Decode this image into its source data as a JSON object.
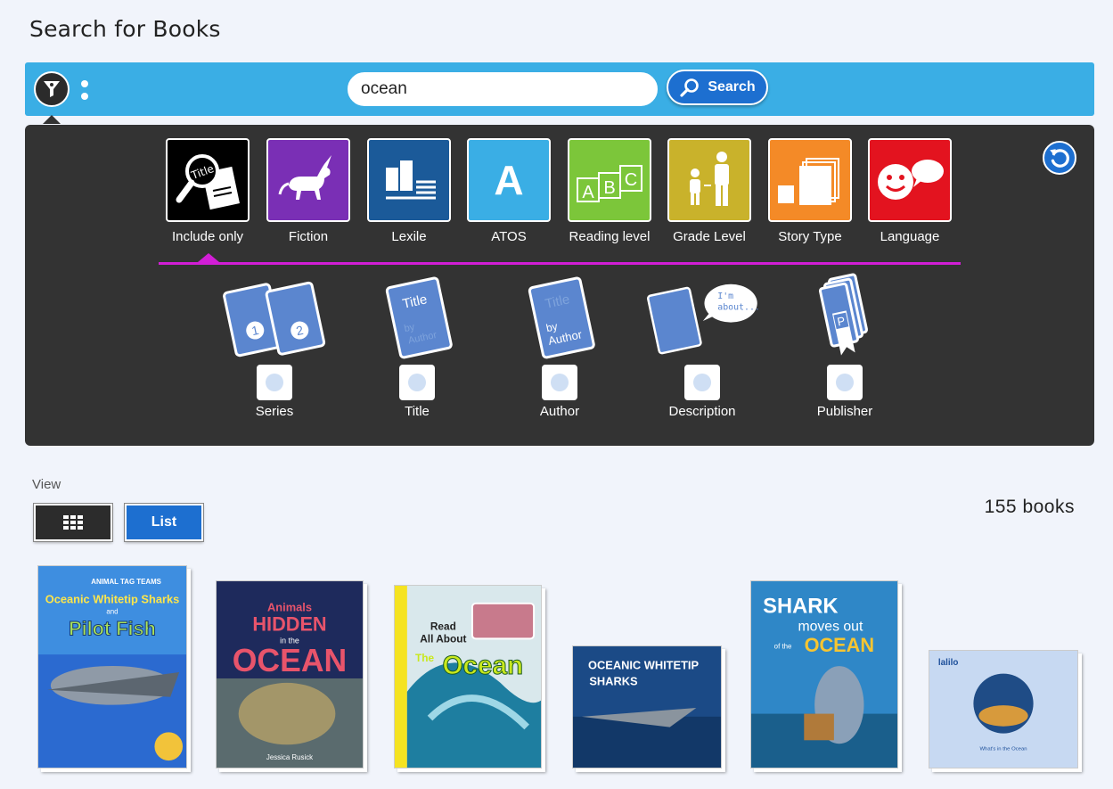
{
  "page": {
    "title": "Search for Books"
  },
  "search": {
    "query": "ocean",
    "button_label": "Search"
  },
  "categories": [
    {
      "label": "Include only",
      "icon": "title-magnifier-icon",
      "color": "#000000"
    },
    {
      "label": "Fiction",
      "icon": "unicorn-icon",
      "color": "#7a2fb5"
    },
    {
      "label": "Lexile",
      "icon": "lexile-books-icon",
      "color": "#1b5a99"
    },
    {
      "label": "ATOS",
      "icon": "atos-letter-icon",
      "letter": "A",
      "color": "#3aaee5"
    },
    {
      "label": "Reading level",
      "icon": "abc-blocks-icon",
      "letters": [
        "A",
        "B",
        "C"
      ],
      "color": "#7cc63a"
    },
    {
      "label": "Grade Level",
      "icon": "people-height-icon",
      "color": "#c9b22b"
    },
    {
      "label": "Story Type",
      "icon": "pages-icon",
      "color": "#f48a27"
    },
    {
      "label": "Language",
      "icon": "speech-bubbles-icon",
      "color": "#e3131f"
    }
  ],
  "search_fields": [
    {
      "label": "Series",
      "icon": "series-books-icon",
      "numbers": [
        "1",
        "2"
      ]
    },
    {
      "label": "Title",
      "icon": "title-book-icon",
      "book_text": [
        "Title",
        "by",
        "Author"
      ]
    },
    {
      "label": "Author",
      "icon": "author-book-icon",
      "book_text": [
        "Title",
        "by",
        "Author"
      ]
    },
    {
      "label": "Description",
      "icon": "description-book-icon",
      "bubble_text": [
        "I'm",
        "about..."
      ]
    },
    {
      "label": "Publisher",
      "icon": "publisher-books-icon",
      "letter": "P"
    }
  ],
  "view": {
    "label": "View",
    "list_label": "List",
    "grid_icon": "grid-icon"
  },
  "results": {
    "count_text": "155 books"
  },
  "books": [
    {
      "lines": [
        "ANIMAL TAG TEAMS",
        "Oceanic Whitetip Sharks",
        "and",
        "Pilot Fish"
      ]
    },
    {
      "lines": [
        "Animals",
        "HIDDEN",
        "in the",
        "OCEAN",
        "Jessica Rusick"
      ]
    },
    {
      "lines": [
        "Read",
        "All About",
        "The",
        "Ocean"
      ]
    },
    {
      "lines": [
        "OCEANIC WHITETIP",
        "SHARKS"
      ]
    },
    {
      "lines": [
        "SHARK",
        "moves out",
        "of the",
        "OCEAN"
      ]
    },
    {
      "lines": [
        "lalilo",
        "What's in the Ocean"
      ]
    }
  ],
  "colors": {
    "accent": "#1d6fd0",
    "bar": "#3aaee5",
    "panel": "#333333",
    "highlight": "#d21ed6"
  }
}
